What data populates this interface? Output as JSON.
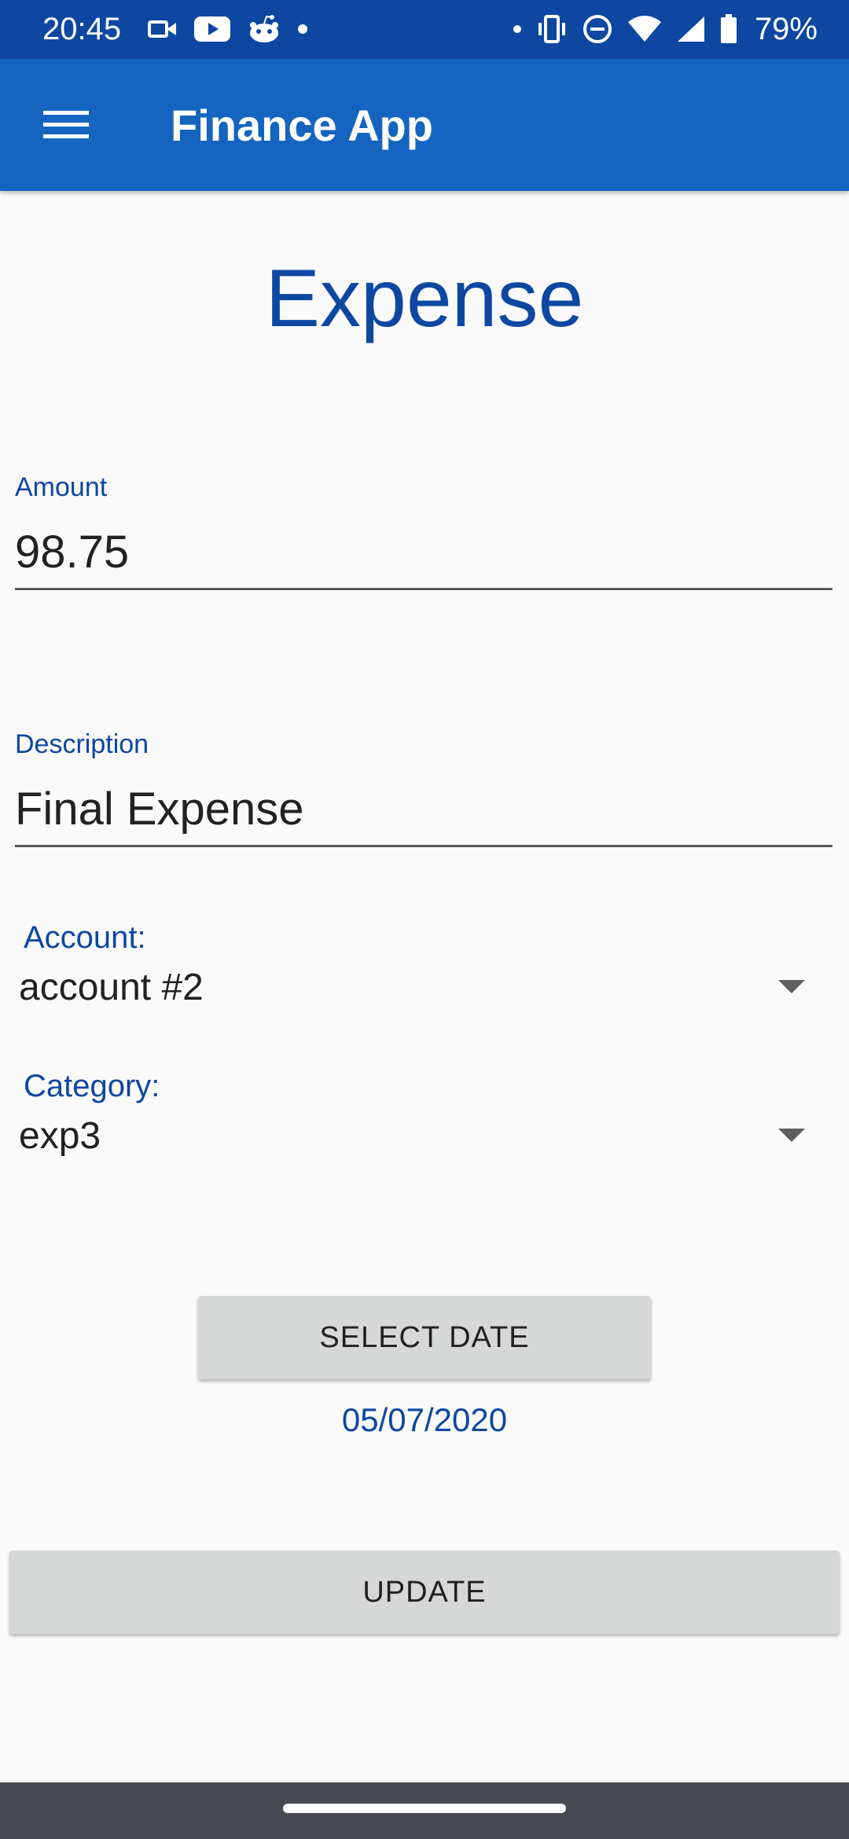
{
  "status_bar": {
    "time": "20:45",
    "battery_percent": "79%",
    "left_icons": [
      "video-camera-icon",
      "youtube-icon",
      "reddit-icon",
      "dot-icon"
    ],
    "right_icons": [
      "dot-icon",
      "vibrate-icon",
      "do-not-disturb-icon",
      "wifi-icon",
      "cell-signal-icon",
      "battery-icon"
    ]
  },
  "app_bar": {
    "title": "Finance App",
    "menu_icon": "hamburger-menu-icon",
    "background_color": "#1565c0"
  },
  "page": {
    "title": "Expense"
  },
  "form": {
    "amount": {
      "label": "Amount",
      "value": "98.75"
    },
    "description": {
      "label": "Description",
      "value": "Final Expense"
    },
    "account": {
      "label": "Account:",
      "selected": "account #2"
    },
    "category": {
      "label": "Category:",
      "selected": "exp3"
    },
    "select_date_label": "SELECT DATE",
    "date": "05/07/2020",
    "update_label": "UPDATE"
  },
  "colors": {
    "accent": "#0d47a1",
    "status_bar": "#0d47a1",
    "button": "#d6d7d7",
    "nav_bar": "#464a50"
  }
}
